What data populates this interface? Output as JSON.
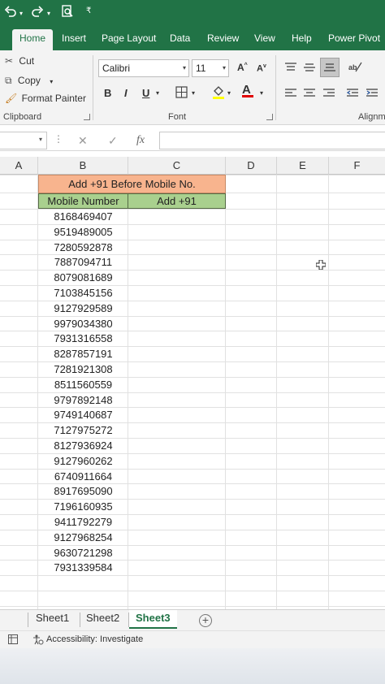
{
  "quick_access": {
    "undo_icon": "undo-icon",
    "redo_icon": "redo-icon",
    "print_preview_icon": "print-preview-icon",
    "customize_icon": "customize-icon"
  },
  "ribbon_tabs": [
    "Home",
    "Insert",
    "Page Layout",
    "Data",
    "Review",
    "View",
    "Help",
    "Power Pivot"
  ],
  "active_tab": "Home",
  "clipboard": {
    "cut": "Cut",
    "copy": "Copy",
    "format_painter": "Format Painter",
    "group_label": "Clipboard"
  },
  "font": {
    "name": "Calibri",
    "size": "11",
    "bold": "B",
    "italic": "I",
    "underline": "U",
    "group_label": "Font"
  },
  "alignment": {
    "group_label": "Alignm"
  },
  "formula_bar": {
    "cancel": "✕",
    "enter": "✓",
    "fx": "fx",
    "value": ""
  },
  "columns": [
    "A",
    "B",
    "C",
    "D",
    "E",
    "F"
  ],
  "sheet": {
    "title": "Add +91 Before Mobile No.",
    "header_b": "Mobile Number",
    "header_c": "Add +91",
    "numbers": [
      "8168469407",
      "9519489005",
      "7280592878",
      "7887094711",
      "8079081689",
      "7103845156",
      "9127929589",
      "9979034380",
      "7931316558",
      "8287857191",
      "7281921308",
      "8511560559",
      "9797892148",
      "9749140687",
      "7127975272",
      "8127936924",
      "9127960262",
      "6740911664",
      "8917695090",
      "7196160935",
      "9411792279",
      "9127968254",
      "9630721298",
      "7931339584"
    ]
  },
  "sheet_tabs": [
    "Sheet1",
    "Sheet2",
    "Sheet3"
  ],
  "active_sheet": "Sheet3",
  "status": {
    "accessibility": "Accessibility: Investigate"
  },
  "colors": {
    "excel_green": "#217346",
    "title_fill": "#f8b48e",
    "header_fill": "#a9d08e"
  }
}
